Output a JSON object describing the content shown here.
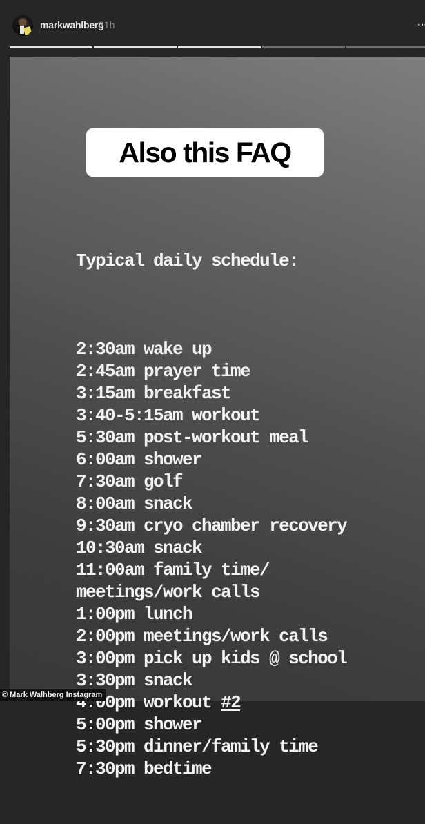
{
  "header": {
    "username": "markwahlberg",
    "timestamp": "21h",
    "more_icon": "⋯",
    "progress": {
      "total_segments": 5,
      "completed_segments": 3
    }
  },
  "story": {
    "label": "Also this FAQ",
    "schedule_heading": "Typical daily schedule:",
    "items": [
      {
        "time": "2:30am",
        "activity": "wake up"
      },
      {
        "time": "2:45am",
        "activity": "prayer time"
      },
      {
        "time": "3:15am",
        "activity": "breakfast"
      },
      {
        "time": "3:40-5:15am",
        "activity": "workout"
      },
      {
        "time": "5:30am",
        "activity": "post-workout meal"
      },
      {
        "time": "6:00am",
        "activity": "shower"
      },
      {
        "time": "7:30am",
        "activity": "golf"
      },
      {
        "time": "8:00am",
        "activity": "snack"
      },
      {
        "time": "9:30am",
        "activity": "cryo chamber recovery"
      },
      {
        "time": "10:30am",
        "activity": "snack"
      },
      {
        "time": "11:00am",
        "activity": "family time/"
      },
      {
        "time": "",
        "activity": "meetings/work calls"
      },
      {
        "time": "1:00pm",
        "activity": "lunch"
      },
      {
        "time": "2:00pm",
        "activity": "meetings/work calls"
      },
      {
        "time": "3:00pm",
        "activity": "pick up kids @ school"
      },
      {
        "time": "3:30pm",
        "activity": "snack"
      },
      {
        "time": "4:00pm",
        "activity": "workout",
        "underlined_suffix": "#2"
      },
      {
        "time": "5:00pm",
        "activity": "shower"
      },
      {
        "time": "5:30pm",
        "activity": "dinner/family time"
      },
      {
        "time": "7:30pm",
        "activity": "bedtime"
      }
    ]
  },
  "credit": "© Mark Walhberg Instagram"
}
